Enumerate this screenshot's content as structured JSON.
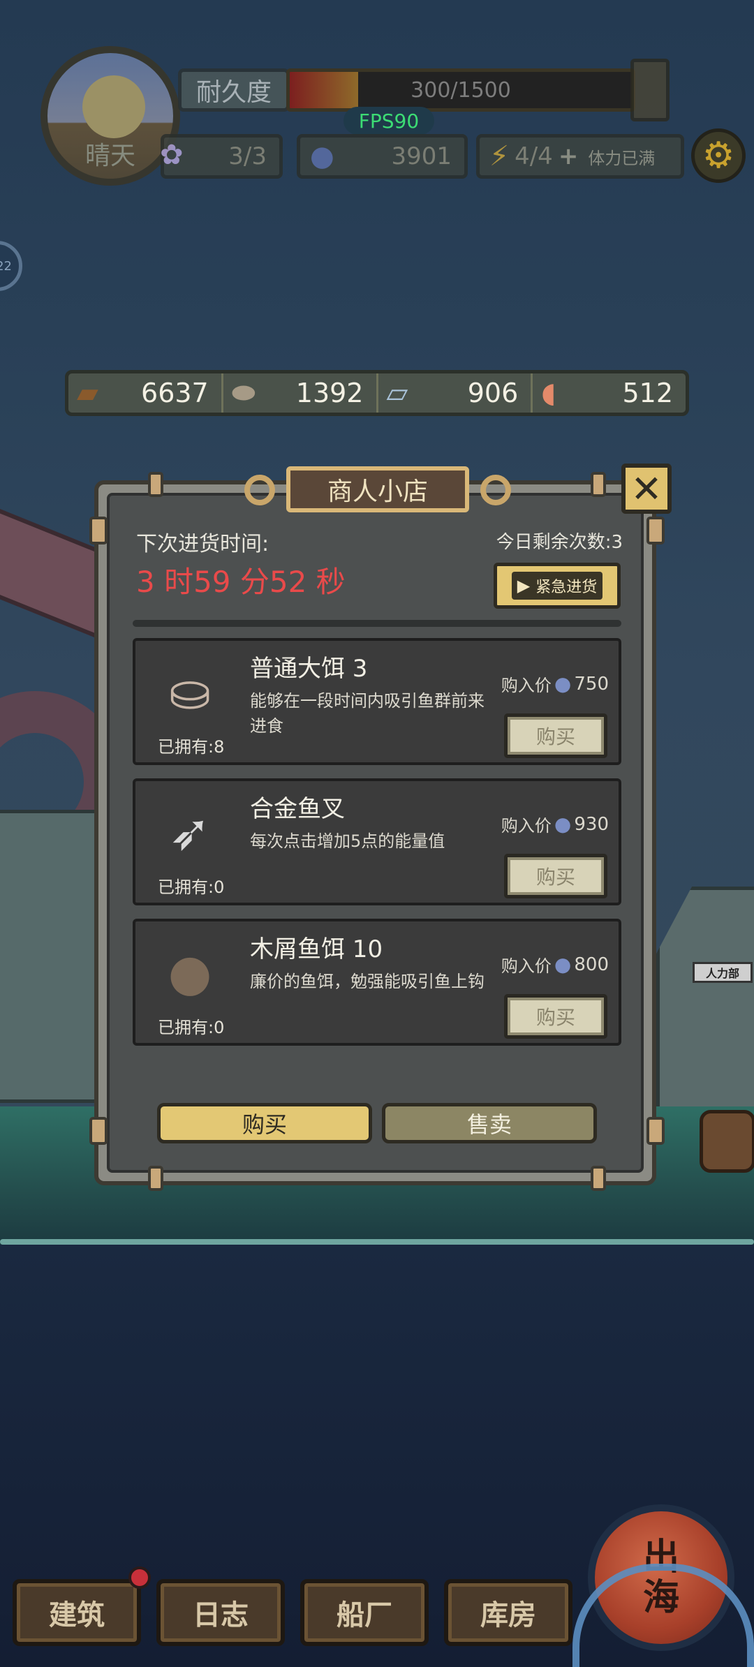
{
  "hud": {
    "weather": "晴天",
    "durability_label": "耐久度",
    "durability_text": "300/1500",
    "durability_level": 0.2,
    "fps": "FPS90",
    "bait_count": "3/3",
    "coins": "3901",
    "energy": "4/4",
    "energy_plus": "+",
    "energy_status": "体力已满",
    "side_badge": "22"
  },
  "resources": [
    {
      "icon": "wood-log-icon",
      "value": "6637"
    },
    {
      "icon": "stone-icon",
      "value": "1392"
    },
    {
      "icon": "iron-ingot-icon",
      "value": "906"
    },
    {
      "icon": "fish-meat-icon",
      "value": "512"
    }
  ],
  "shop": {
    "title": "商人小店",
    "restock_label": "下次进货时间:",
    "countdown": "3 时59 分52 秒",
    "remaining": "今日剩余次数:3",
    "urgent_label": "紧急进货",
    "items": [
      {
        "name": "普通大饵 3",
        "desc": "能够在一段时间内吸引鱼群前来进食",
        "owned": "已拥有:8",
        "price_label": "购入价",
        "price": "750",
        "buy": "购买"
      },
      {
        "name": "合金鱼叉",
        "desc": "每次点击增加5点的能量值",
        "owned": "已拥有:0",
        "price_label": "购入价",
        "price": "930",
        "buy": "购买"
      },
      {
        "name": "木屑鱼饵 10",
        "desc": "廉价的鱼饵，勉强能吸引鱼上钩",
        "owned": "已拥有:0",
        "price_label": "购入价",
        "price": "800",
        "buy": "购买"
      }
    ],
    "tab_buy": "购买",
    "tab_sell": "售卖"
  },
  "scene": {
    "sign_text": "人力部"
  },
  "nav": {
    "items": [
      "建筑",
      "日志",
      "船厂",
      "库房"
    ],
    "go_sea": "出海"
  }
}
